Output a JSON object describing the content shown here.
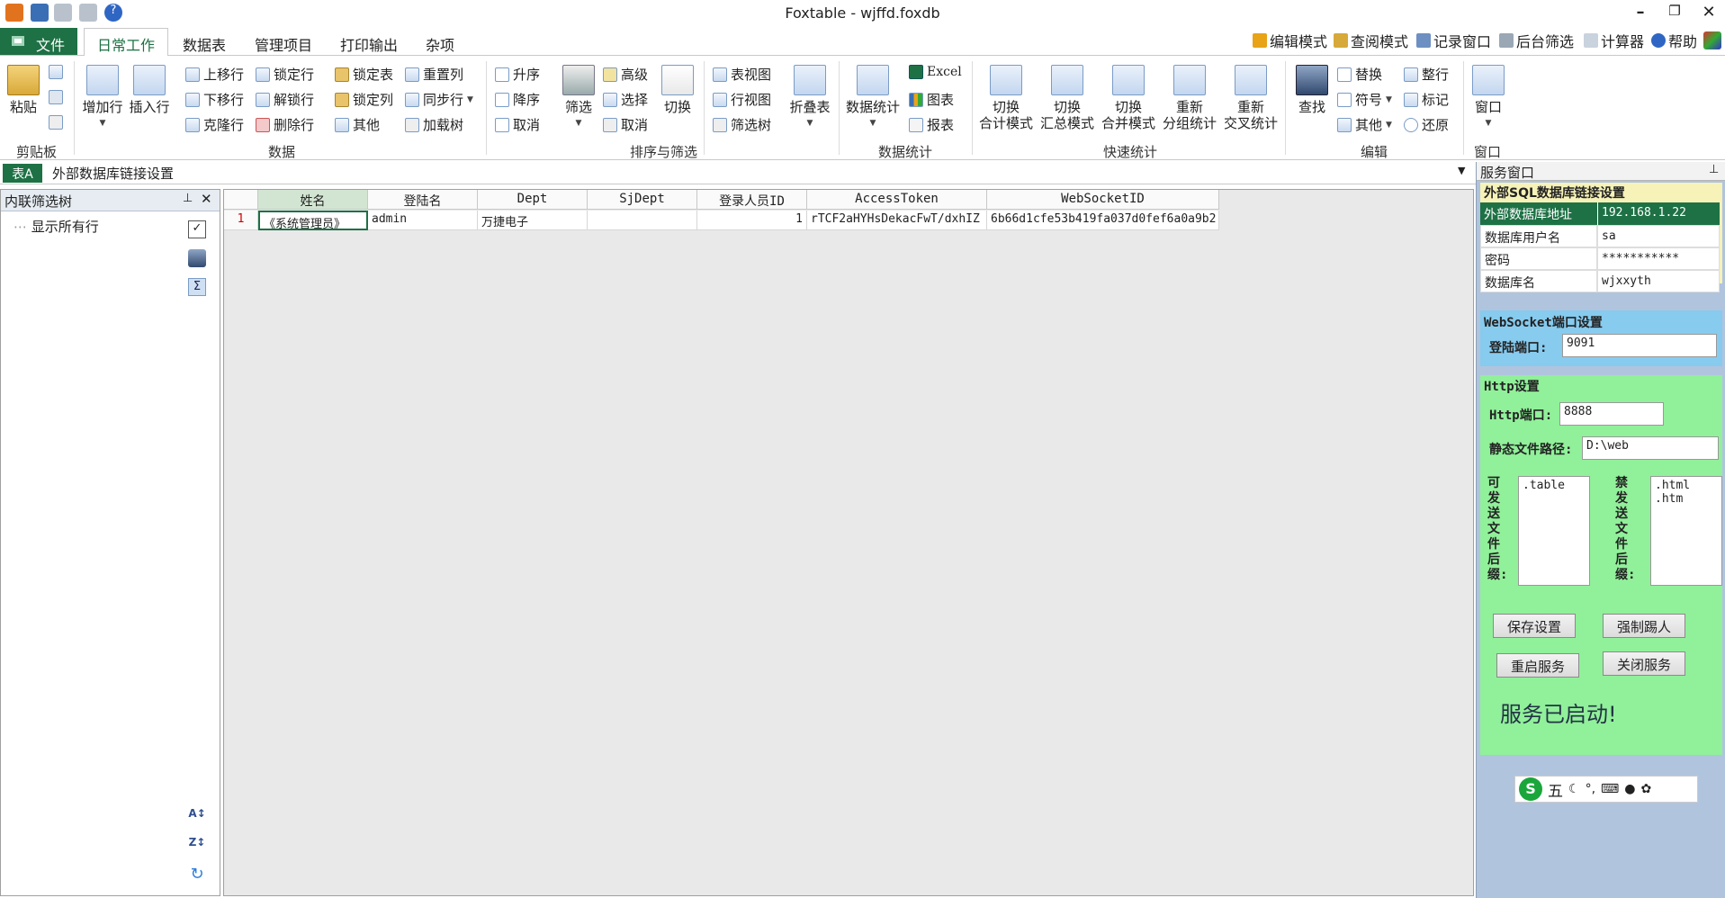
{
  "window": {
    "title": "Foxtable - wjffd.foxdb"
  },
  "menubar": {
    "file": "文件",
    "tabs": [
      "日常工作",
      "数据表",
      "管理项目",
      "打印输出",
      "杂项"
    ],
    "right_tools": [
      "编辑模式",
      "查阅模式",
      "记录窗口",
      "后台筛选",
      "计算器",
      "帮助"
    ]
  },
  "ribbon": {
    "clipboard": {
      "paste": "粘贴",
      "label": "剪贴板"
    },
    "data": {
      "add_row": "增加行",
      "insert_row": "插入行",
      "move_up": "上移行",
      "move_down": "下移行",
      "clone_row": "克隆行",
      "lock_row": "锁定行",
      "unlock_row": "解锁行",
      "delete_row": "删除行",
      "lock_table": "锁定表",
      "lock_col": "锁定列",
      "other": "其他",
      "reset_col": "重置列",
      "sync_row": "同步行",
      "load_tree": "加载树",
      "label": "数据"
    },
    "sort": {
      "asc": "升序",
      "desc": "降序",
      "cancel": "取消",
      "filter": "筛选",
      "advanced": "高级",
      "select": "选择",
      "cancel2": "取消",
      "switch": "切换",
      "label": "排序与筛选"
    },
    "views": {
      "table_view": "表视图",
      "row_view": "行视图",
      "filter_tree": "筛选树",
      "fold_table": "折叠表"
    },
    "stats": {
      "data_stats": "数据统计",
      "excel": "Excel",
      "chart": "图表",
      "report": "报表",
      "label": "数据统计"
    },
    "quick": {
      "b1": [
        "切换",
        "合计模式"
      ],
      "b2": [
        "切换",
        "汇总模式"
      ],
      "b3": [
        "切换",
        "合并模式"
      ],
      "b4": [
        "重新",
        "分组统计"
      ],
      "b5": [
        "重新",
        "交叉统计"
      ],
      "label": "快速统计"
    },
    "edit": {
      "find": "查找",
      "replace": "替换",
      "symbol": "符号",
      "other": "其他",
      "tidy_row": "整行",
      "mark": "标记",
      "restore": "还原",
      "label": "编辑"
    },
    "window": {
      "window": "窗口",
      "label": "窗口"
    }
  },
  "table_tab": {
    "badge": "表A",
    "name": "外部数据库链接设置"
  },
  "left_panel": {
    "title": "内联筛选树",
    "item": "显示所有行"
  },
  "grid": {
    "columns": [
      "姓名",
      "登陆名",
      "Dept",
      "SjDept",
      "登录人员ID",
      "AccessToken",
      "WebSocketID"
    ],
    "rows": [
      {
        "num": "1",
        "cells": [
          "《系统管理员》",
          "admin",
          "万捷电子",
          "",
          "1",
          "rTCF2aHYHsDekacFwT/dxhIZ",
          "6b66d1cfe53b419fa037d0fef6a0a9b2"
        ]
      }
    ]
  },
  "service": {
    "title": "服务窗口",
    "sql_title": "外部SQL数据库链接设置",
    "sql": [
      {
        "k": "外部数据库地址",
        "v": "192.168.1.22"
      },
      {
        "k": "数据库用户名",
        "v": "sa"
      },
      {
        "k": "密码",
        "v": "***********"
      },
      {
        "k": "数据库名",
        "v": "wjxxyth"
      }
    ],
    "ws_title": "WebSocket端口设置",
    "ws_port_label": "登陆端口:",
    "ws_port": "9091",
    "http_title": "Http设置",
    "http_port_label": "Http端口:",
    "http_port": "8888",
    "static_path_label": "静态文件路径:",
    "static_path": "D:\\web",
    "allow_label": "可发送文件后缀:",
    "allow_list": ".table",
    "deny_label": "禁发送文件后缀:",
    "deny_list": ".html\n.htm",
    "buttons": [
      "保存设置",
      "强制踢人",
      "重启服务",
      "关闭服务"
    ],
    "status": "服务已启动!",
    "ime": "五"
  }
}
